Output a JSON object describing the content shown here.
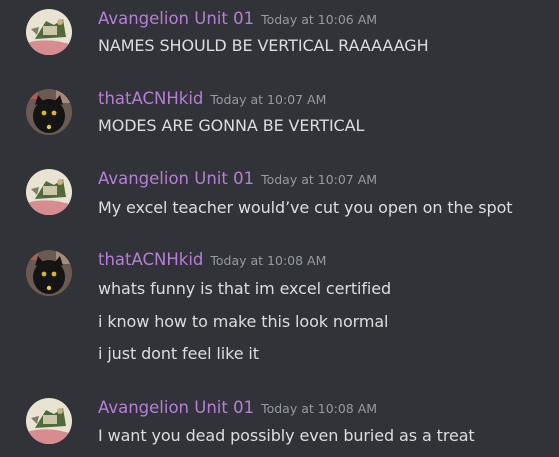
{
  "messages": [
    {
      "author": "Avangelion Unit 01",
      "avatar_icon": "avangelion-avatar-icon",
      "timestamp": "Today at 10:06 AM",
      "lines": [
        "NAMES SHOULD BE VERTICAL RAAAAAGH"
      ]
    },
    {
      "author": "thatACNHkid",
      "avatar_icon": "black-cat-avatar-icon",
      "timestamp": "Today at 10:07 AM",
      "lines": [
        "MODES ARE GONNA BE VERTICAL"
      ]
    },
    {
      "author": "Avangelion Unit 01",
      "avatar_icon": "avangelion-avatar-icon",
      "timestamp": "Today at 10:07 AM",
      "lines": [
        "My excel teacher would’ve cut you open on the spot"
      ]
    },
    {
      "author": "thatACNHkid",
      "avatar_icon": "black-cat-avatar-icon",
      "timestamp": "Today at 10:08 AM",
      "lines": [
        "whats funny is that im excel certified",
        "i know how to make this look normal",
        "i just dont feel like it"
      ]
    },
    {
      "author": "Avangelion Unit 01",
      "avatar_icon": "avangelion-avatar-icon",
      "timestamp": "Today at 10:08 AM",
      "lines": [
        "I want you dead possibly even buried as a treat"
      ]
    }
  ],
  "colors": {
    "background": "#313338",
    "username": "#b57fd6",
    "timestamp": "#949ba4",
    "text": "#dbdee1"
  }
}
